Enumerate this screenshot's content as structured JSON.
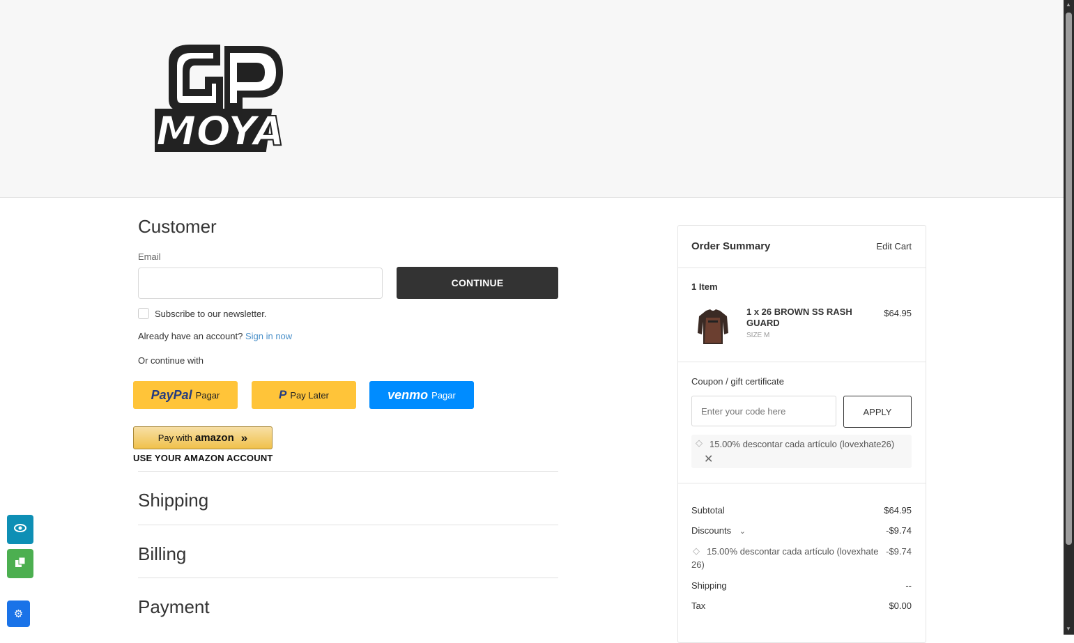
{
  "brand": {
    "name": "MOYA"
  },
  "customer": {
    "title": "Customer",
    "email_label": "Email",
    "email_value": "",
    "continue_label": "CONTINUE",
    "newsletter_label": "Subscribe to our newsletter.",
    "account_prompt": "Already have an account?",
    "sign_in_label": "Sign in now",
    "continue_with": "Or continue with"
  },
  "payment_buttons": {
    "paypal": {
      "brand": "PayPal",
      "label": "Pagar"
    },
    "paylater": {
      "label": "Pay Later"
    },
    "venmo": {
      "brand": "venmo",
      "label": "Pagar"
    },
    "amazon": {
      "pre": "Pay with",
      "brand": "amazon",
      "caption": "USE YOUR AMAZON ACCOUNT"
    }
  },
  "sections": {
    "shipping": "Shipping",
    "billing": "Billing",
    "payment": "Payment"
  },
  "summary": {
    "title": "Order Summary",
    "edit_cart": "Edit Cart",
    "item_count": "1 Item",
    "item": {
      "name_line1": "1 x 26 BROWN SS RASH",
      "name_line2": "GUARD",
      "variant": "SIZE M",
      "price": "$64.95"
    },
    "coupon_link": "Coupon / gift certificate",
    "coupon_placeholder": "Enter your code here",
    "apply_label": "APPLY",
    "applied_coupon": "15.00% descontar cada artículo (lovexhate26)",
    "subtotal_label": "Subtotal",
    "subtotal_value": "$64.95",
    "discounts_label": "Discounts",
    "discounts_value": "-$9.74",
    "discount_detail_line1": "15.00% descontar cada artículo (lovexhate",
    "discount_detail_line2": "26)",
    "discount_detail_value": "-$9.74",
    "shipping_label": "Shipping",
    "shipping_value": "--",
    "tax_label": "Tax",
    "tax_value": "$0.00"
  },
  "colors": {
    "accent_link": "#4a90c9",
    "paypal_yellow": "#ffc439",
    "venmo_blue": "#008cff",
    "dark_button": "#333333"
  },
  "side_tools": [
    {
      "icon": "eye-icon"
    },
    {
      "icon": "copy-icon"
    },
    {
      "icon": "gear-icon"
    }
  ]
}
